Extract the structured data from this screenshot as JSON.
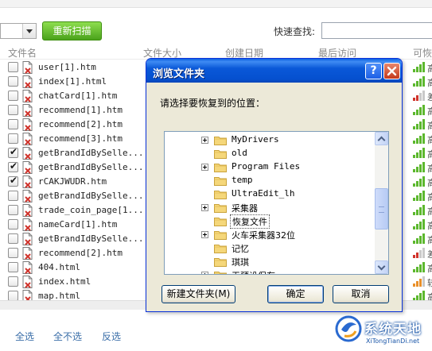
{
  "toolbar": {
    "rescan_label": "重新扫描",
    "quick_find_label": "快速查找:",
    "quick_find_value": ""
  },
  "columns": [
    "文件名",
    "文件大小",
    "创建日期",
    "最后访问",
    "可恢"
  ],
  "files": [
    {
      "name": "user[1].htm",
      "checked": false,
      "signal": "green",
      "chan": "高"
    },
    {
      "name": "index[1].html",
      "checked": false,
      "signal": "green",
      "chan": "高"
    },
    {
      "name": "chatCard[1].htm",
      "checked": false,
      "signal": "partial",
      "chan": "差"
    },
    {
      "name": "recommend[1].htm",
      "checked": false,
      "signal": "green",
      "chan": "高"
    },
    {
      "name": "recommend[2].htm",
      "checked": false,
      "signal": "green",
      "chan": "高"
    },
    {
      "name": "recommend[3].htm",
      "checked": false,
      "signal": "green",
      "chan": "高"
    },
    {
      "name": "getBrandIdBySelle...",
      "checked": true,
      "signal": "green",
      "chan": "高"
    },
    {
      "name": "getBrandIdBySelle...",
      "checked": true,
      "signal": "green",
      "chan": "高"
    },
    {
      "name": "rCAKJWUDR.htm",
      "checked": true,
      "signal": "green",
      "chan": "高"
    },
    {
      "name": "getBrandIdBySelle...",
      "checked": false,
      "signal": "green",
      "chan": "高"
    },
    {
      "name": "trade_coin_page[1...",
      "checked": false,
      "signal": "green",
      "chan": "高"
    },
    {
      "name": "nameCard[1].htm",
      "checked": false,
      "signal": "green",
      "chan": "高"
    },
    {
      "name": "getBrandIdBySelle...",
      "checked": false,
      "signal": "green",
      "chan": "高"
    },
    {
      "name": "recommend[2].htm",
      "checked": false,
      "signal": "partial",
      "chan": "差"
    },
    {
      "name": "404.html",
      "checked": false,
      "signal": "green",
      "chan": "高"
    },
    {
      "name": "index.html",
      "checked": false,
      "signal": "orange",
      "chan": "较"
    },
    {
      "name": "map.html",
      "checked": false,
      "signal": "green",
      "chan": "高"
    }
  ],
  "bottom": {
    "select_all": "全选",
    "select_none": "全不选",
    "invert": "反选"
  },
  "dialog": {
    "title": "浏览文件夹",
    "help": "?",
    "prompt": "请选择要恢复到的位置：",
    "folders": [
      {
        "label": "MyDrivers",
        "expandable": true,
        "mono": true
      },
      {
        "label": "old",
        "expandable": false,
        "mono": true
      },
      {
        "label": "Program Files",
        "expandable": true,
        "mono": true
      },
      {
        "label": "temp",
        "expandable": false,
        "mono": true
      },
      {
        "label": "UltraEdit_lh",
        "expandable": false,
        "mono": true
      },
      {
        "label": "采集器",
        "expandable": true,
        "mono": false
      },
      {
        "label": "恢复文件",
        "expandable": false,
        "mono": false,
        "selected": true
      },
      {
        "label": "火车采集器32位",
        "expandable": true,
        "mono": false
      },
      {
        "label": "记忆",
        "expandable": false,
        "mono": false
      },
      {
        "label": "琪琪",
        "expandable": false,
        "mono": false
      },
      {
        "label": "无预设保存",
        "expandable": true,
        "mono": false
      }
    ],
    "new_folder_label": "新建文件夹(M)",
    "ok_label": "确定",
    "cancel_label": "取消"
  },
  "watermark": {
    "title": "系统天地",
    "url": "XiTongTianDi.net"
  },
  "colors": {
    "accent_green": "#4aa21b",
    "titlebar_blue": "#0550cf",
    "dialog_bg": "#ece9d8",
    "signal_green": "#5cb82e",
    "signal_red": "#d0342c",
    "signal_orange": "#e9902a"
  }
}
